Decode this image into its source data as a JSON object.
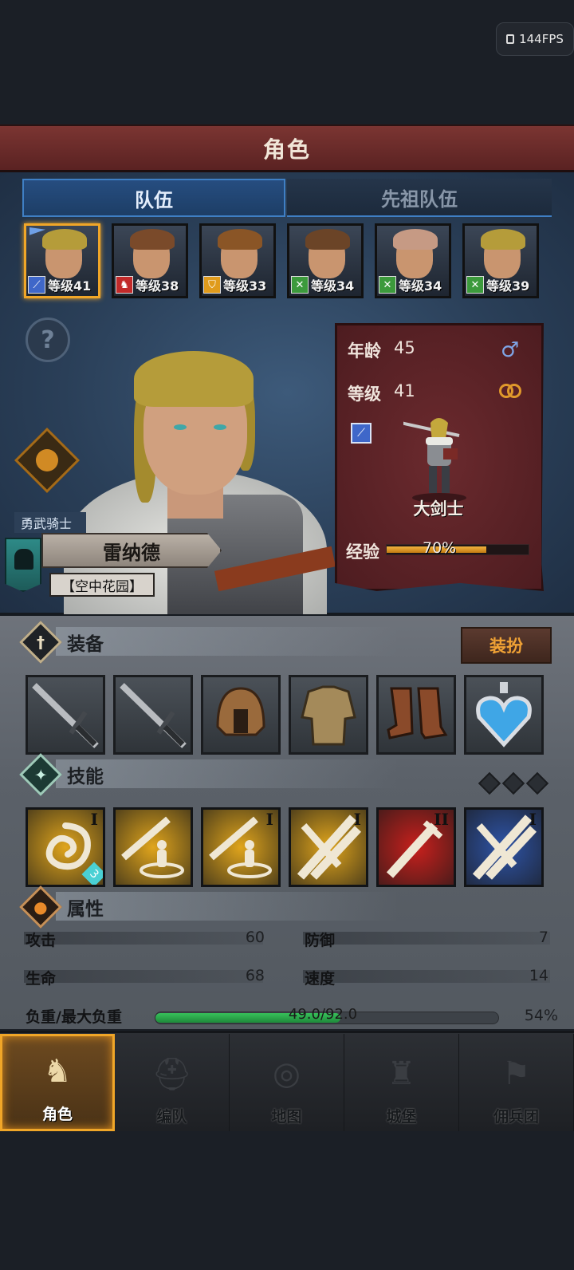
{
  "status": {
    "fps_label": "144FPS"
  },
  "header": {
    "title": "角色"
  },
  "tabs": [
    {
      "label": "队伍",
      "active": true
    },
    {
      "label": "先祖队伍",
      "active": false
    }
  ],
  "party": [
    {
      "level_text": "等级41",
      "class_icon": "sword-icon",
      "class_color": "#3f67c9",
      "hair_color": "#b59c3a",
      "selected": true,
      "flag": true
    },
    {
      "level_text": "等级38",
      "class_icon": "horse-icon",
      "class_color": "#c22a2a",
      "hair_color": "#7a4a2a",
      "selected": false
    },
    {
      "level_text": "等级33",
      "class_icon": "shield-icon",
      "class_color": "#e09b1c",
      "hair_color": "#8a5526",
      "selected": false
    },
    {
      "level_text": "等级34",
      "class_icon": "crossed-icon",
      "class_color": "#3c9a3c",
      "hair_color": "#6b4427",
      "selected": false
    },
    {
      "level_text": "等级34",
      "class_icon": "crossed-icon",
      "class_color": "#3c9a3c",
      "hair_color": "#c69a84",
      "selected": false
    },
    {
      "level_text": "等级39",
      "class_icon": "crossed-icon",
      "class_color": "#3c9a3c",
      "hair_color": "#b59c3a",
      "selected": false
    }
  ],
  "hero": {
    "title": "勇武骑士",
    "name": "雷纳德",
    "location": "【空中花园】",
    "age_label": "年龄",
    "age": "45",
    "level_label": "等级",
    "level": "41",
    "class_name": "大剑士",
    "exp_label": "经验",
    "exp_percent_text": "70%",
    "exp_fraction": 0.7
  },
  "equipment": {
    "title": "装备",
    "dress_button": "装扮",
    "slots": [
      "greatsword-icon",
      "greatsword-icon",
      "helmet-icon",
      "armor-icon",
      "boots-icon",
      "amulet-icon"
    ]
  },
  "skills": {
    "title": "技能",
    "items": [
      {
        "name": "whirlwind-skill-icon",
        "tier": "I",
        "bg": "#e0a51c",
        "badge": "3"
      },
      {
        "name": "sword-guard-skill-icon",
        "tier": "",
        "bg": "#e0a51c"
      },
      {
        "name": "sword-guard-skill-icon",
        "tier": "I",
        "bg": "#e0a51c"
      },
      {
        "name": "crossed-swords-skill-icon",
        "tier": "I",
        "bg": "#e0a51c"
      },
      {
        "name": "sword-strike-skill-icon",
        "tier": "II",
        "bg": "#c8201c"
      },
      {
        "name": "crossed-swords-skill-icon",
        "tier": "I",
        "bg": "#2e54a8"
      }
    ]
  },
  "attributes": {
    "title": "属性",
    "attack_label": "攻击",
    "attack": "60",
    "defense_label": "防御",
    "defense": "7",
    "hp_label": "生命",
    "hp": "68",
    "speed_label": "速度",
    "speed": "14",
    "weight_label": "负重/最大负重",
    "weight_text": "49.0/92.0",
    "weight_percent_text": "54%",
    "weight_fraction": 0.54
  },
  "nav": [
    {
      "label": "角色",
      "icon": "knight-icon",
      "active": true
    },
    {
      "label": "编队",
      "icon": "helmet-group-icon",
      "active": false
    },
    {
      "label": "地图",
      "icon": "compass-icon",
      "active": false
    },
    {
      "label": "城堡",
      "icon": "castle-icon",
      "active": false
    },
    {
      "label": "佣兵团",
      "icon": "banner-icon",
      "active": false
    }
  ]
}
